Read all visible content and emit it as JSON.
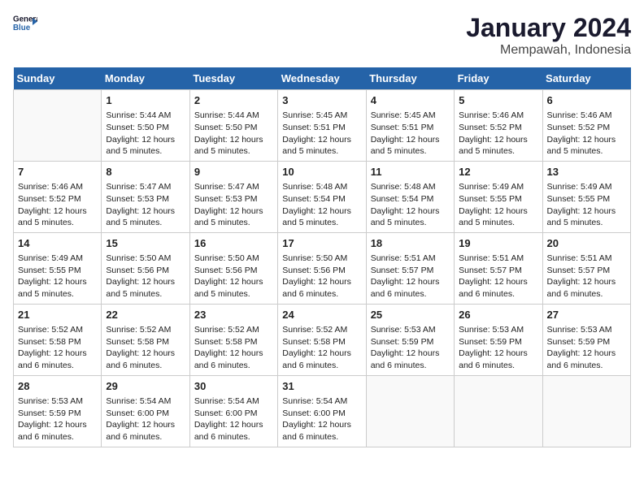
{
  "header": {
    "logo_line1": "General",
    "logo_line2": "Blue",
    "month_year": "January 2024",
    "location": "Mempawah, Indonesia"
  },
  "days_of_week": [
    "Sunday",
    "Monday",
    "Tuesday",
    "Wednesday",
    "Thursday",
    "Friday",
    "Saturday"
  ],
  "weeks": [
    [
      {
        "day": "",
        "info": ""
      },
      {
        "day": "1",
        "info": "Sunrise: 5:44 AM\nSunset: 5:50 PM\nDaylight: 12 hours\nand 5 minutes."
      },
      {
        "day": "2",
        "info": "Sunrise: 5:44 AM\nSunset: 5:50 PM\nDaylight: 12 hours\nand 5 minutes."
      },
      {
        "day": "3",
        "info": "Sunrise: 5:45 AM\nSunset: 5:51 PM\nDaylight: 12 hours\nand 5 minutes."
      },
      {
        "day": "4",
        "info": "Sunrise: 5:45 AM\nSunset: 5:51 PM\nDaylight: 12 hours\nand 5 minutes."
      },
      {
        "day": "5",
        "info": "Sunrise: 5:46 AM\nSunset: 5:52 PM\nDaylight: 12 hours\nand 5 minutes."
      },
      {
        "day": "6",
        "info": "Sunrise: 5:46 AM\nSunset: 5:52 PM\nDaylight: 12 hours\nand 5 minutes."
      }
    ],
    [
      {
        "day": "7",
        "info": "Sunrise: 5:46 AM\nSunset: 5:52 PM\nDaylight: 12 hours\nand 5 minutes."
      },
      {
        "day": "8",
        "info": "Sunrise: 5:47 AM\nSunset: 5:53 PM\nDaylight: 12 hours\nand 5 minutes."
      },
      {
        "day": "9",
        "info": "Sunrise: 5:47 AM\nSunset: 5:53 PM\nDaylight: 12 hours\nand 5 minutes."
      },
      {
        "day": "10",
        "info": "Sunrise: 5:48 AM\nSunset: 5:54 PM\nDaylight: 12 hours\nand 5 minutes."
      },
      {
        "day": "11",
        "info": "Sunrise: 5:48 AM\nSunset: 5:54 PM\nDaylight: 12 hours\nand 5 minutes."
      },
      {
        "day": "12",
        "info": "Sunrise: 5:49 AM\nSunset: 5:55 PM\nDaylight: 12 hours\nand 5 minutes."
      },
      {
        "day": "13",
        "info": "Sunrise: 5:49 AM\nSunset: 5:55 PM\nDaylight: 12 hours\nand 5 minutes."
      }
    ],
    [
      {
        "day": "14",
        "info": "Sunrise: 5:49 AM\nSunset: 5:55 PM\nDaylight: 12 hours\nand 5 minutes."
      },
      {
        "day": "15",
        "info": "Sunrise: 5:50 AM\nSunset: 5:56 PM\nDaylight: 12 hours\nand 5 minutes."
      },
      {
        "day": "16",
        "info": "Sunrise: 5:50 AM\nSunset: 5:56 PM\nDaylight: 12 hours\nand 5 minutes."
      },
      {
        "day": "17",
        "info": "Sunrise: 5:50 AM\nSunset: 5:56 PM\nDaylight: 12 hours\nand 6 minutes."
      },
      {
        "day": "18",
        "info": "Sunrise: 5:51 AM\nSunset: 5:57 PM\nDaylight: 12 hours\nand 6 minutes."
      },
      {
        "day": "19",
        "info": "Sunrise: 5:51 AM\nSunset: 5:57 PM\nDaylight: 12 hours\nand 6 minutes."
      },
      {
        "day": "20",
        "info": "Sunrise: 5:51 AM\nSunset: 5:57 PM\nDaylight: 12 hours\nand 6 minutes."
      }
    ],
    [
      {
        "day": "21",
        "info": "Sunrise: 5:52 AM\nSunset: 5:58 PM\nDaylight: 12 hours\nand 6 minutes."
      },
      {
        "day": "22",
        "info": "Sunrise: 5:52 AM\nSunset: 5:58 PM\nDaylight: 12 hours\nand 6 minutes."
      },
      {
        "day": "23",
        "info": "Sunrise: 5:52 AM\nSunset: 5:58 PM\nDaylight: 12 hours\nand 6 minutes."
      },
      {
        "day": "24",
        "info": "Sunrise: 5:52 AM\nSunset: 5:58 PM\nDaylight: 12 hours\nand 6 minutes."
      },
      {
        "day": "25",
        "info": "Sunrise: 5:53 AM\nSunset: 5:59 PM\nDaylight: 12 hours\nand 6 minutes."
      },
      {
        "day": "26",
        "info": "Sunrise: 5:53 AM\nSunset: 5:59 PM\nDaylight: 12 hours\nand 6 minutes."
      },
      {
        "day": "27",
        "info": "Sunrise: 5:53 AM\nSunset: 5:59 PM\nDaylight: 12 hours\nand 6 minutes."
      }
    ],
    [
      {
        "day": "28",
        "info": "Sunrise: 5:53 AM\nSunset: 5:59 PM\nDaylight: 12 hours\nand 6 minutes."
      },
      {
        "day": "29",
        "info": "Sunrise: 5:54 AM\nSunset: 6:00 PM\nDaylight: 12 hours\nand 6 minutes."
      },
      {
        "day": "30",
        "info": "Sunrise: 5:54 AM\nSunset: 6:00 PM\nDaylight: 12 hours\nand 6 minutes."
      },
      {
        "day": "31",
        "info": "Sunrise: 5:54 AM\nSunset: 6:00 PM\nDaylight: 12 hours\nand 6 minutes."
      },
      {
        "day": "",
        "info": ""
      },
      {
        "day": "",
        "info": ""
      },
      {
        "day": "",
        "info": ""
      }
    ]
  ]
}
